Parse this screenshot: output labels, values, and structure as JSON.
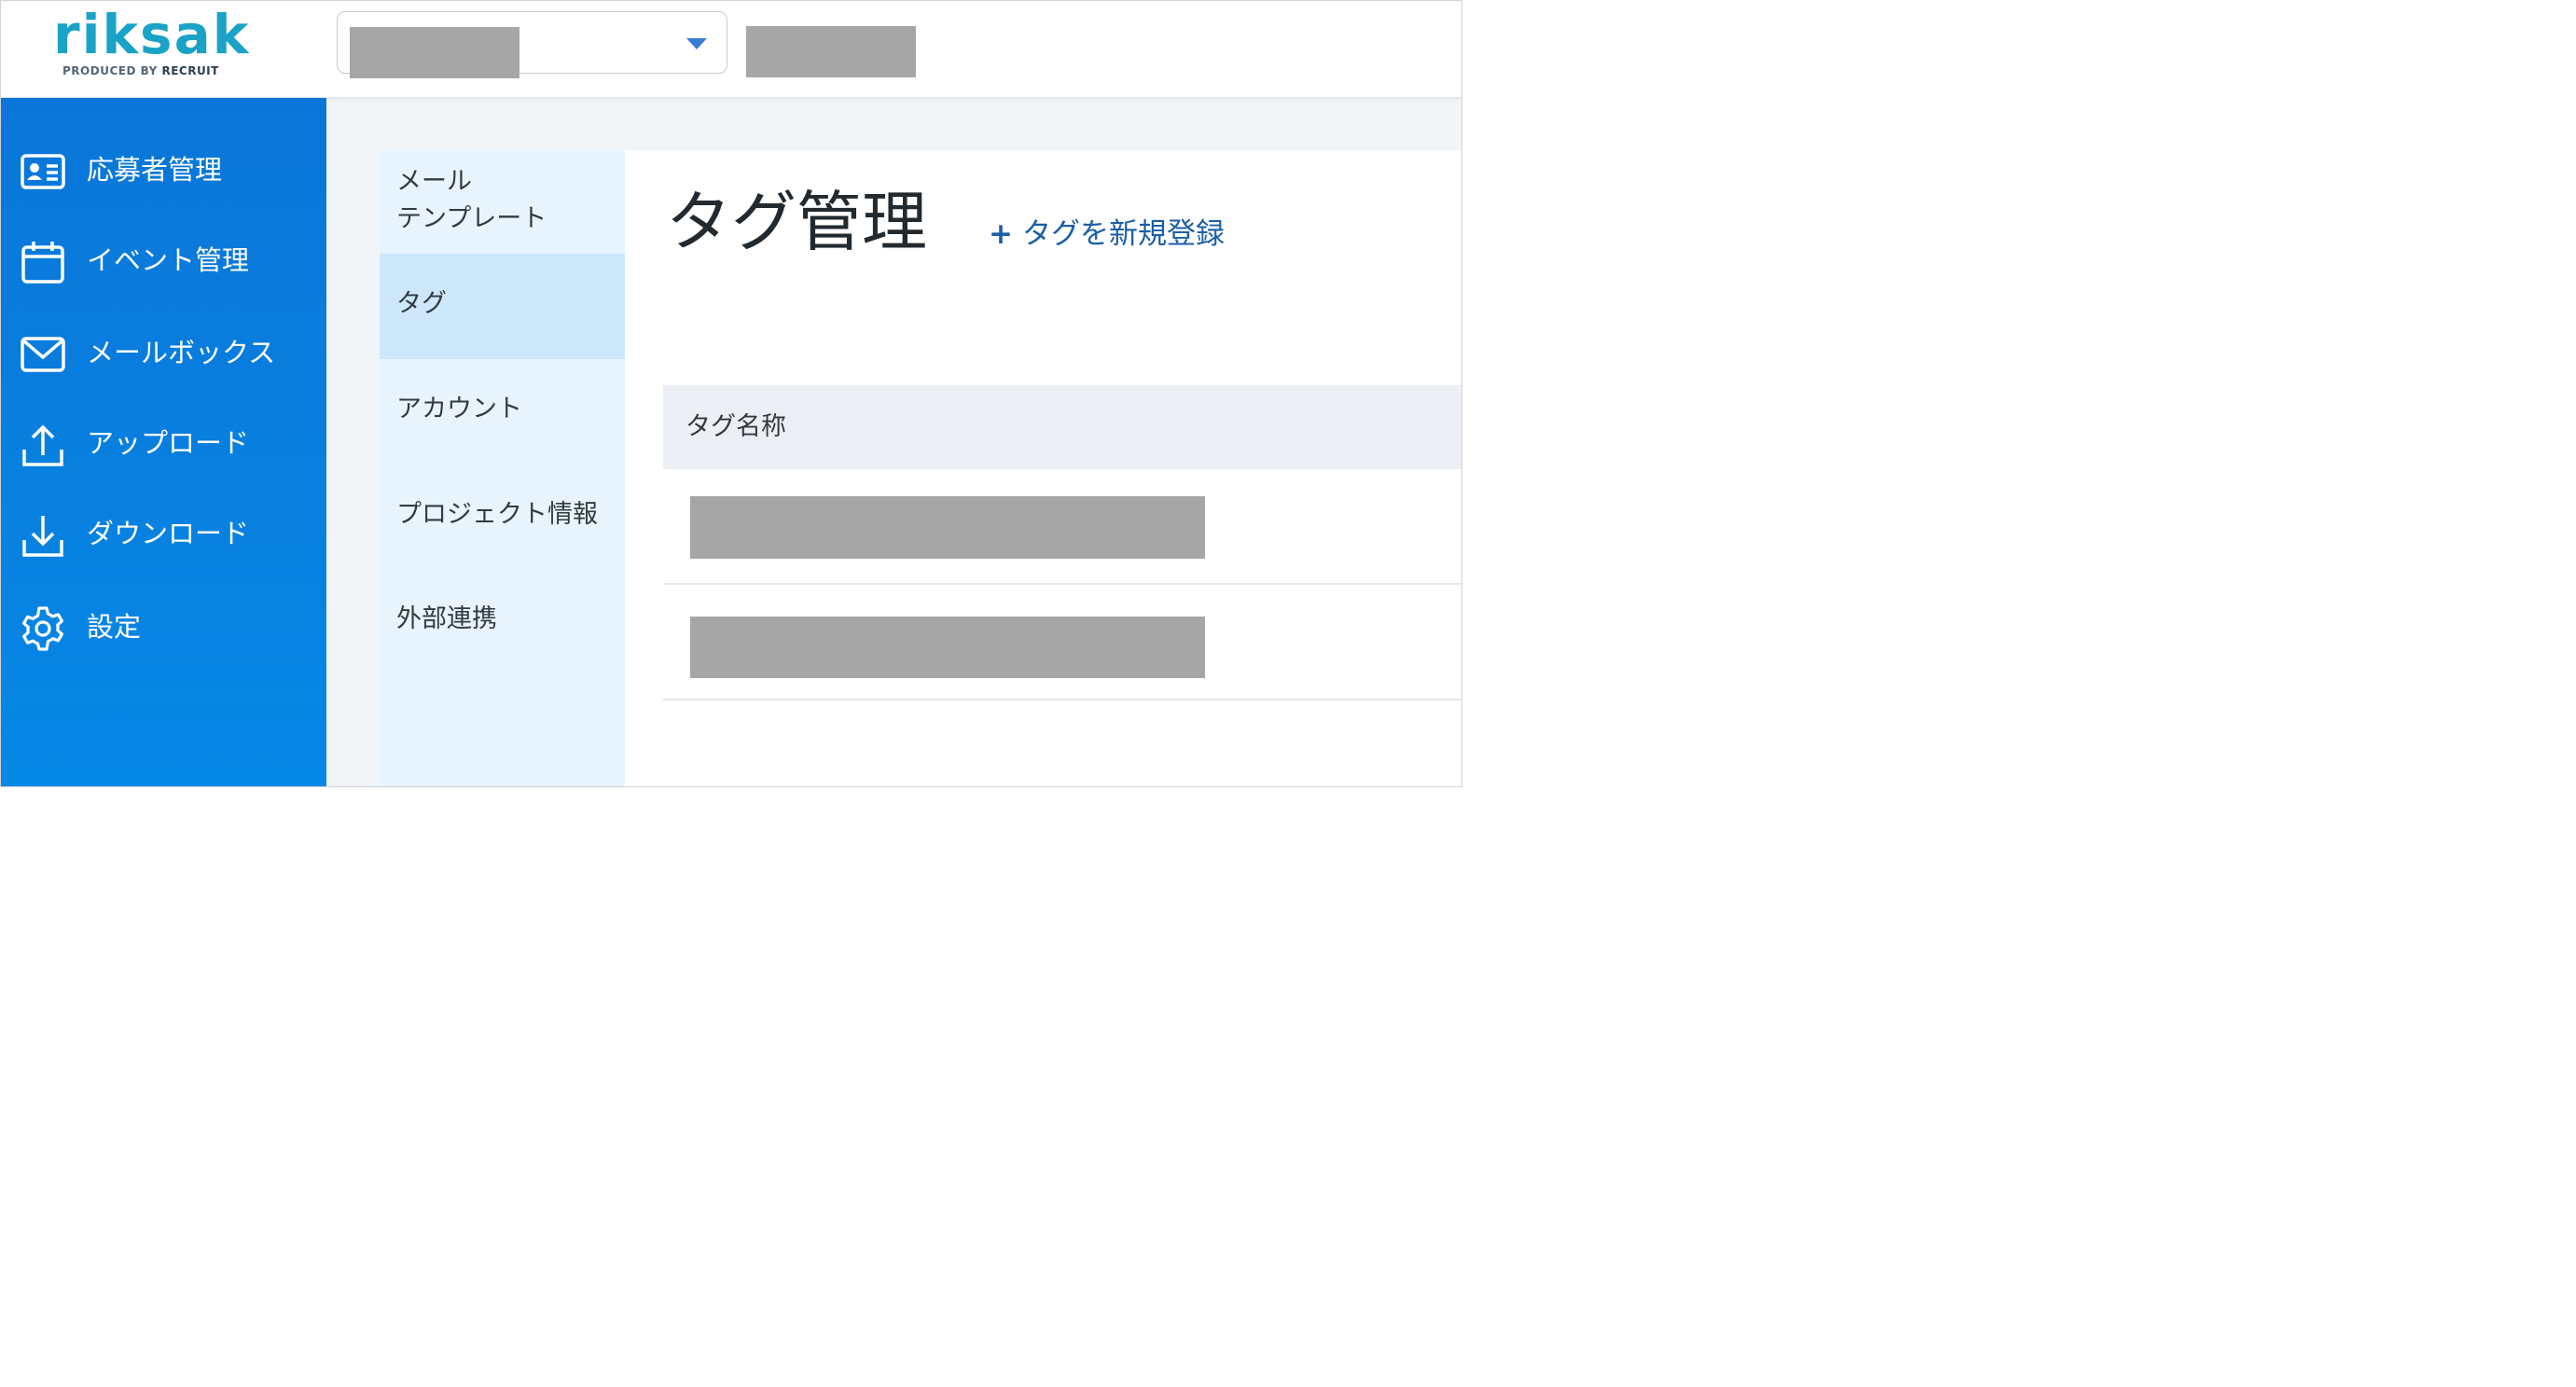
{
  "header": {
    "logo_text": "riksak",
    "logo_sub_prefix": "PRODUCED BY ",
    "logo_sub_brand": "RECRUIT"
  },
  "sidebar": {
    "items": [
      {
        "label": "応募者管理",
        "icon": "id-card-icon"
      },
      {
        "label": "イベント管理",
        "icon": "calendar-icon"
      },
      {
        "label": "メールボックス",
        "icon": "mail-icon"
      },
      {
        "label": "アップロード",
        "icon": "upload-icon"
      },
      {
        "label": "ダウンロード",
        "icon": "download-icon"
      },
      {
        "label": "設定",
        "icon": "gear-icon"
      }
    ]
  },
  "submenu": {
    "items": [
      {
        "label": "メール\nテンプレート"
      },
      {
        "label": "タグ",
        "active": true
      },
      {
        "label": "アカウント"
      },
      {
        "label": "プロジェクト情報"
      },
      {
        "label": "外部連携"
      }
    ]
  },
  "main": {
    "title": "タグ管理",
    "add_plus": "+",
    "add_label": "タグを新規登録",
    "table": {
      "column_header": "タグ名称"
    }
  },
  "colors": {
    "sidebar": "#0b76d8",
    "submenu": "#e8f4fd",
    "submenu_active": "#cde8fb",
    "accent_link": "#1b5ea8",
    "logo": "#1aa3c6",
    "redacted": "#a6a6a6"
  }
}
